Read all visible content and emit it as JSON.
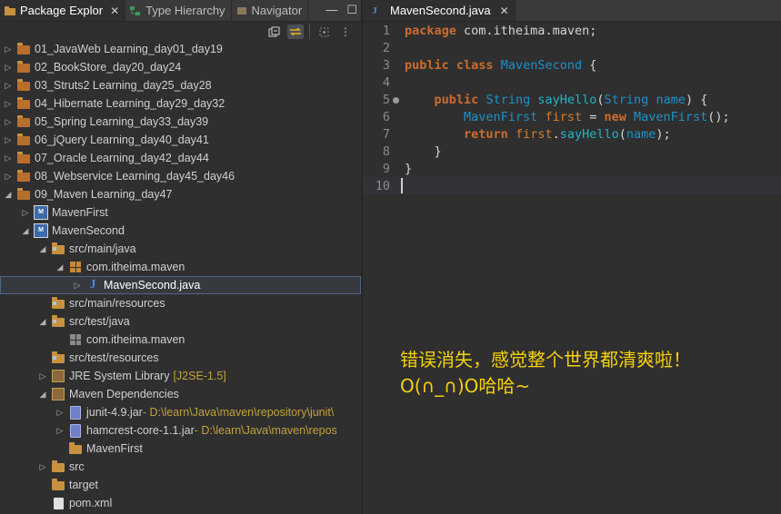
{
  "left_panel": {
    "tabs": [
      {
        "label": "Package Explor",
        "icon": "package-explorer-icon",
        "active": true
      },
      {
        "label": "Type Hierarchy",
        "icon": "type-hierarchy-icon",
        "active": false
      },
      {
        "label": "Navigator",
        "icon": "navigator-icon",
        "active": false
      }
    ],
    "tree": [
      {
        "label": "01_JavaWeb Learning_day01_day19",
        "level": 0,
        "icon": "project-folder-icon"
      },
      {
        "label": "02_BookStore_day20_day24",
        "level": 0,
        "icon": "project-folder-icon"
      },
      {
        "label": "03_Struts2 Learning_day25_day28",
        "level": 0,
        "icon": "project-folder-icon"
      },
      {
        "label": "04_Hibernate Learning_day29_day32",
        "level": 0,
        "icon": "project-folder-icon"
      },
      {
        "label": "05_Spring Learning_day33_day39",
        "level": 0,
        "icon": "project-folder-icon"
      },
      {
        "label": "06_jQuery Learning_day40_day41",
        "level": 0,
        "icon": "project-folder-icon"
      },
      {
        "label": "07_Oracle Learning_day42_day44",
        "level": 0,
        "icon": "project-folder-icon"
      },
      {
        "label": "08_Webservice Learning_day45_day46",
        "level": 0,
        "icon": "project-folder-icon"
      },
      {
        "label": "09_Maven Learning_day47",
        "level": 0,
        "icon": "project-folder-icon",
        "expanded": true
      },
      {
        "label": "MavenFirst",
        "level": 1,
        "icon": "maven-project-icon"
      },
      {
        "label": "MavenSecond",
        "level": 1,
        "icon": "maven-project-icon",
        "expanded": true
      },
      {
        "label": "src/main/java",
        "level": 2,
        "icon": "source-folder-icon",
        "expanded": true
      },
      {
        "label": "com.itheima.maven",
        "level": 3,
        "icon": "package-icon",
        "expanded": true
      },
      {
        "label": "MavenSecond.java",
        "level": 4,
        "icon": "java-file-icon",
        "selected": true
      },
      {
        "label": "src/main/resources",
        "level": 2,
        "icon": "source-folder-icon"
      },
      {
        "label": "src/test/java",
        "level": 2,
        "icon": "source-folder-icon",
        "expanded": true
      },
      {
        "label": "com.itheima.maven",
        "level": 3,
        "icon": "empty-package-icon"
      },
      {
        "label": "src/test/resources",
        "level": 2,
        "icon": "source-folder-icon"
      },
      {
        "label": "JRE System Library",
        "deco": "[J2SE-1.5]",
        "level": 2,
        "icon": "library-icon"
      },
      {
        "label": "Maven Dependencies",
        "level": 2,
        "icon": "library-icon",
        "expanded": true
      },
      {
        "label": "junit-4.9.jar",
        "deco": " - D:\\learn\\Java\\maven\\repository\\junit\\",
        "level": 3,
        "icon": "jar-icon"
      },
      {
        "label": "hamcrest-core-1.1.jar",
        "deco": " - D:\\learn\\Java\\maven\\repos",
        "level": 3,
        "icon": "jar-icon"
      },
      {
        "label": "MavenFirst",
        "level": 3,
        "icon": "folder-icon"
      },
      {
        "label": "src",
        "level": 2,
        "icon": "folder-icon"
      },
      {
        "label": "target",
        "level": 2,
        "icon": "folder-icon"
      },
      {
        "label": "pom.xml",
        "level": 2,
        "icon": "xml-file-icon"
      }
    ]
  },
  "editor": {
    "tab_label": "MavenSecond.java",
    "tab_close": "✕",
    "lines": [
      "1",
      "2",
      "3",
      "4",
      "5",
      "6",
      "7",
      "8",
      "9",
      "10"
    ]
  },
  "overlay": {
    "line1": "错误消失，感觉整个世界都清爽啦！",
    "line2": "O(∩_∩)O哈哈~"
  },
  "colors": {
    "keyword": "#cc6c2d",
    "type": "#1e90c9",
    "overlay_text": "#f5d10a"
  }
}
